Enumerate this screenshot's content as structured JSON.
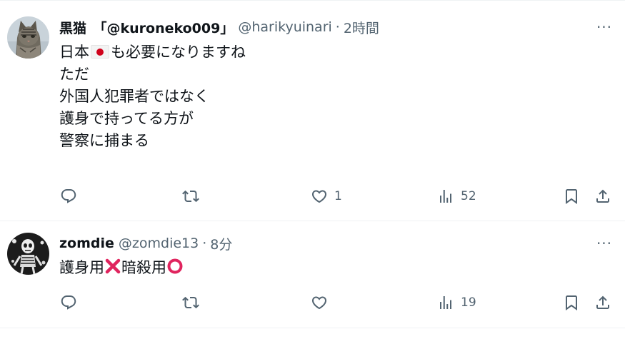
{
  "tweets": [
    {
      "name": "黒猫　「@kuroneko009」",
      "handle": "@harikyuinari",
      "dot": "·",
      "time": "2時間",
      "avatar_icon": "cat-avatar",
      "lines": {
        "line1_a": "日本",
        "line1_b": "も必要になりますね",
        "rest": "\nただ\n外国人犯罪者ではなく\n護身で持ってる方が\n警察に捕まる"
      },
      "replies": "",
      "retweets": "",
      "likes": "1",
      "views": "52"
    },
    {
      "name": "zomdie",
      "handle": "@zomdie13",
      "dot": "·",
      "time": "8分",
      "avatar_icon": "skeleton-avatar",
      "lines": {
        "part_a": "護身用",
        "part_b": "暗殺用"
      },
      "replies": "",
      "retweets": "",
      "likes": "",
      "views": "19"
    }
  ],
  "more_label": "···",
  "colors": {
    "text": "#0f1419",
    "secondary": "#536471",
    "divider": "#eff3f4",
    "flag_red": "#d0021b",
    "cross_red": "#e0245e"
  }
}
